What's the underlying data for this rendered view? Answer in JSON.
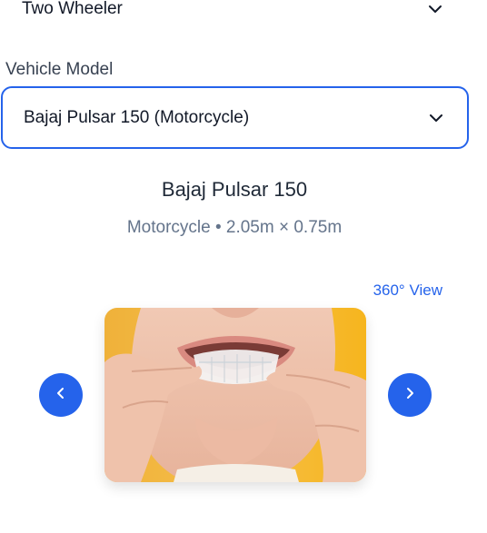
{
  "vehicle_type": {
    "value": "Two Wheeler"
  },
  "vehicle_model": {
    "label": "Vehicle Model",
    "value": "Bajaj Pulsar 150 (Motorcycle)"
  },
  "details": {
    "title": "Bajaj Pulsar 150",
    "subtitle": "Motorcycle • 2.05m × 0.75m"
  },
  "gallery": {
    "view_360_label": "360° View"
  },
  "colors": {
    "accent": "#2563eb",
    "photo_background": "#f6b51e"
  },
  "icons": {
    "select_chevron": "chevron-down-icon",
    "prev": "chevron-left-icon",
    "next": "chevron-right-icon"
  }
}
